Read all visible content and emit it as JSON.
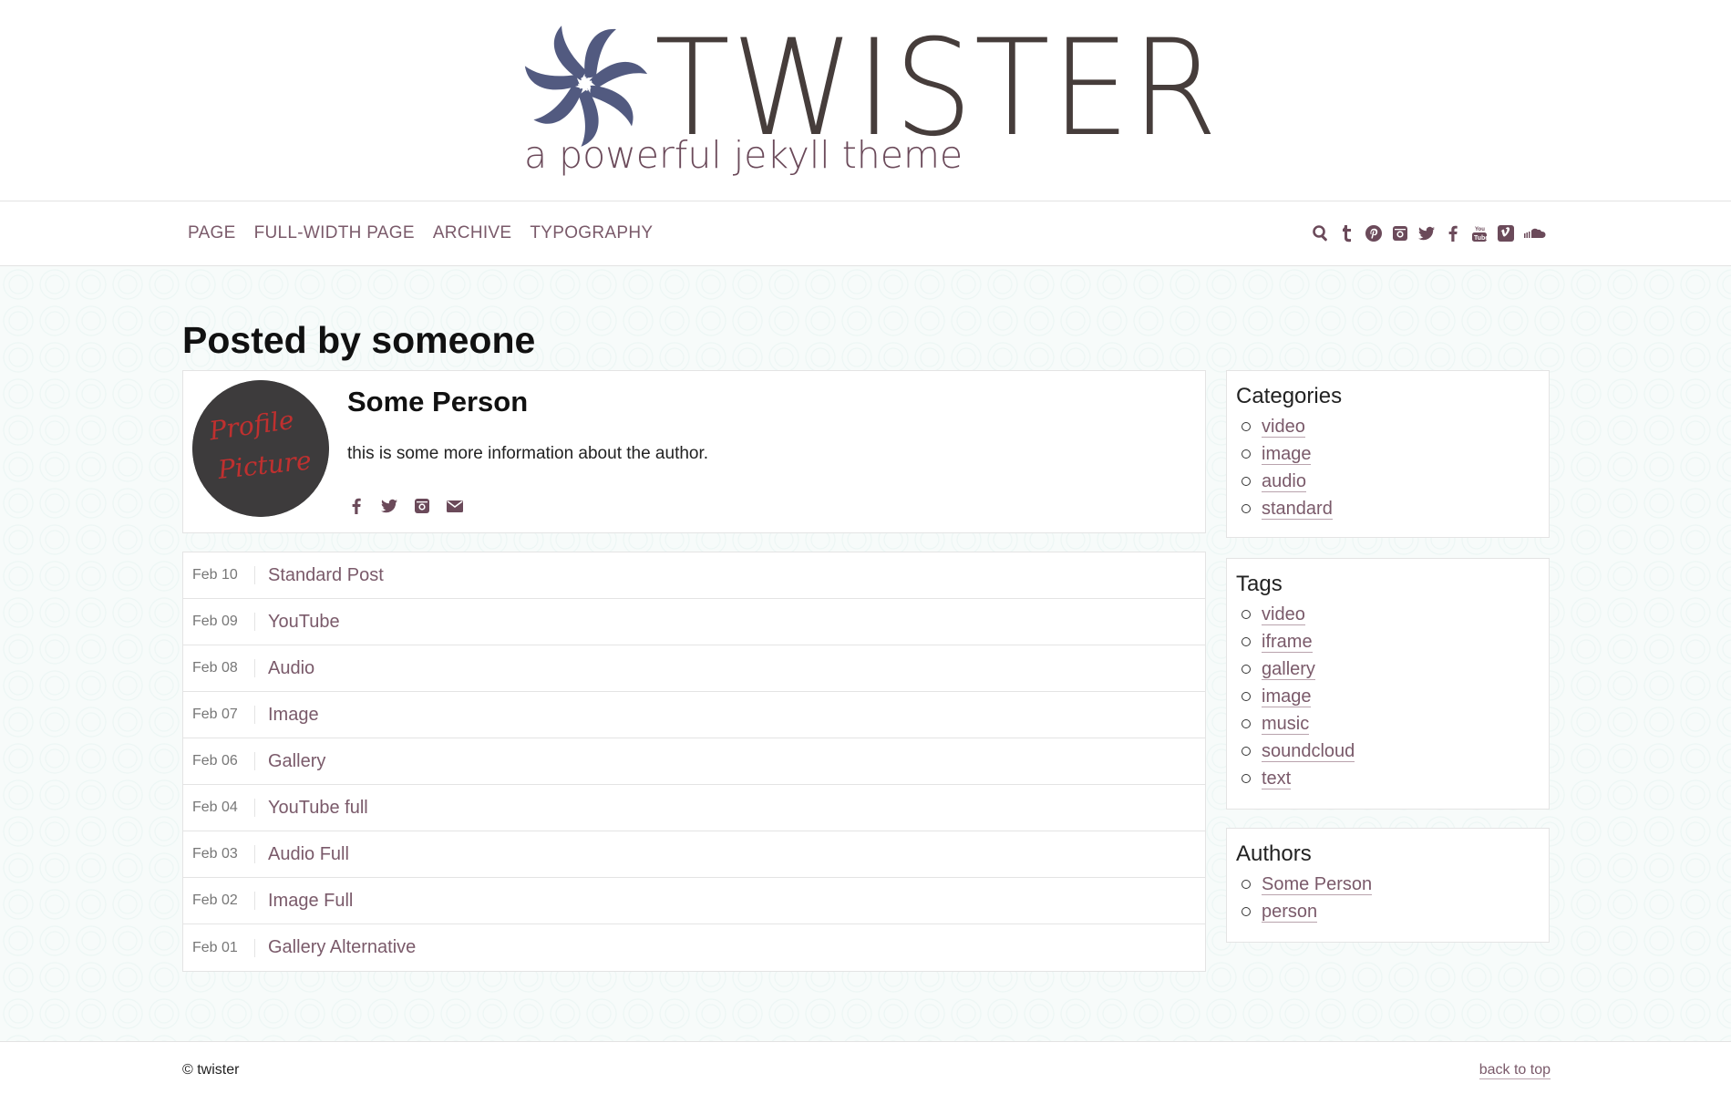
{
  "site": {
    "title": "TWISTER",
    "tagline": "a powerful jekyll theme",
    "logo_color": "#525a80",
    "accent": "#7a5a6a"
  },
  "nav": {
    "links": [
      {
        "label": "PAGE"
      },
      {
        "label": "FULL-WIDTH PAGE"
      },
      {
        "label": "ARCHIVE"
      },
      {
        "label": "TYPOGRAPHY"
      }
    ],
    "icons": [
      "search-icon",
      "tumblr-icon",
      "pinterest-icon",
      "instagram-icon",
      "twitter-icon",
      "facebook-icon",
      "youtube-icon",
      "vimeo-icon",
      "soundcloud-icon"
    ]
  },
  "page": {
    "title": "Posted by someone"
  },
  "author": {
    "avatar_text_1": "Profile",
    "avatar_text_2": "Picture",
    "name": "Some Person",
    "bio": "this is some more information about the author.",
    "social_icons": [
      "facebook-icon",
      "twitter-icon",
      "instagram-icon",
      "envelope-icon"
    ]
  },
  "posts": [
    {
      "date": "Feb 10",
      "title": "Standard Post"
    },
    {
      "date": "Feb 09",
      "title": "YouTube"
    },
    {
      "date": "Feb 08",
      "title": "Audio"
    },
    {
      "date": "Feb 07",
      "title": "Image"
    },
    {
      "date": "Feb 06",
      "title": "Gallery"
    },
    {
      "date": "Feb 04",
      "title": "YouTube full"
    },
    {
      "date": "Feb 03",
      "title": "Audio Full"
    },
    {
      "date": "Feb 02",
      "title": "Image Full"
    },
    {
      "date": "Feb 01",
      "title": "Gallery Alternative"
    }
  ],
  "sidebar": {
    "categories": {
      "title": "Categories",
      "items": [
        "video",
        "image",
        "audio",
        "standard"
      ]
    },
    "tags": {
      "title": "Tags",
      "items": [
        "video",
        "iframe",
        "gallery",
        "image",
        "music",
        "soundcloud",
        "text"
      ]
    },
    "authors": {
      "title": "Authors",
      "items": [
        "Some Person",
        "person"
      ]
    }
  },
  "footer": {
    "copyright": "© twister",
    "back_to_top": "back to top"
  }
}
